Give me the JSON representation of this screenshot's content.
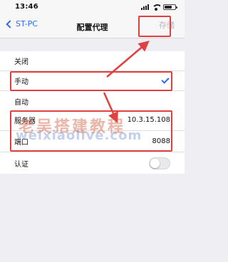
{
  "status_bar": {
    "time": "13:46"
  },
  "nav": {
    "back_label": "ST-PC",
    "title": "配置代理",
    "save_label": "存储"
  },
  "mode_options": [
    {
      "label": "关闭",
      "selected": false
    },
    {
      "label": "手动",
      "selected": true
    },
    {
      "label": "自动",
      "selected": false
    }
  ],
  "settings": {
    "server_label": "服务器",
    "server_value": "10.3.15.108",
    "port_label": "端口",
    "port_value": "8088",
    "auth_label": "认证",
    "auth_enabled": false
  },
  "watermark": {
    "line1": "老吴搭建教程",
    "line2": "weixiaolive.com"
  },
  "colors": {
    "accent": "#2a6cf6",
    "highlight": "#e23f3f",
    "background": "#eeeef3"
  }
}
